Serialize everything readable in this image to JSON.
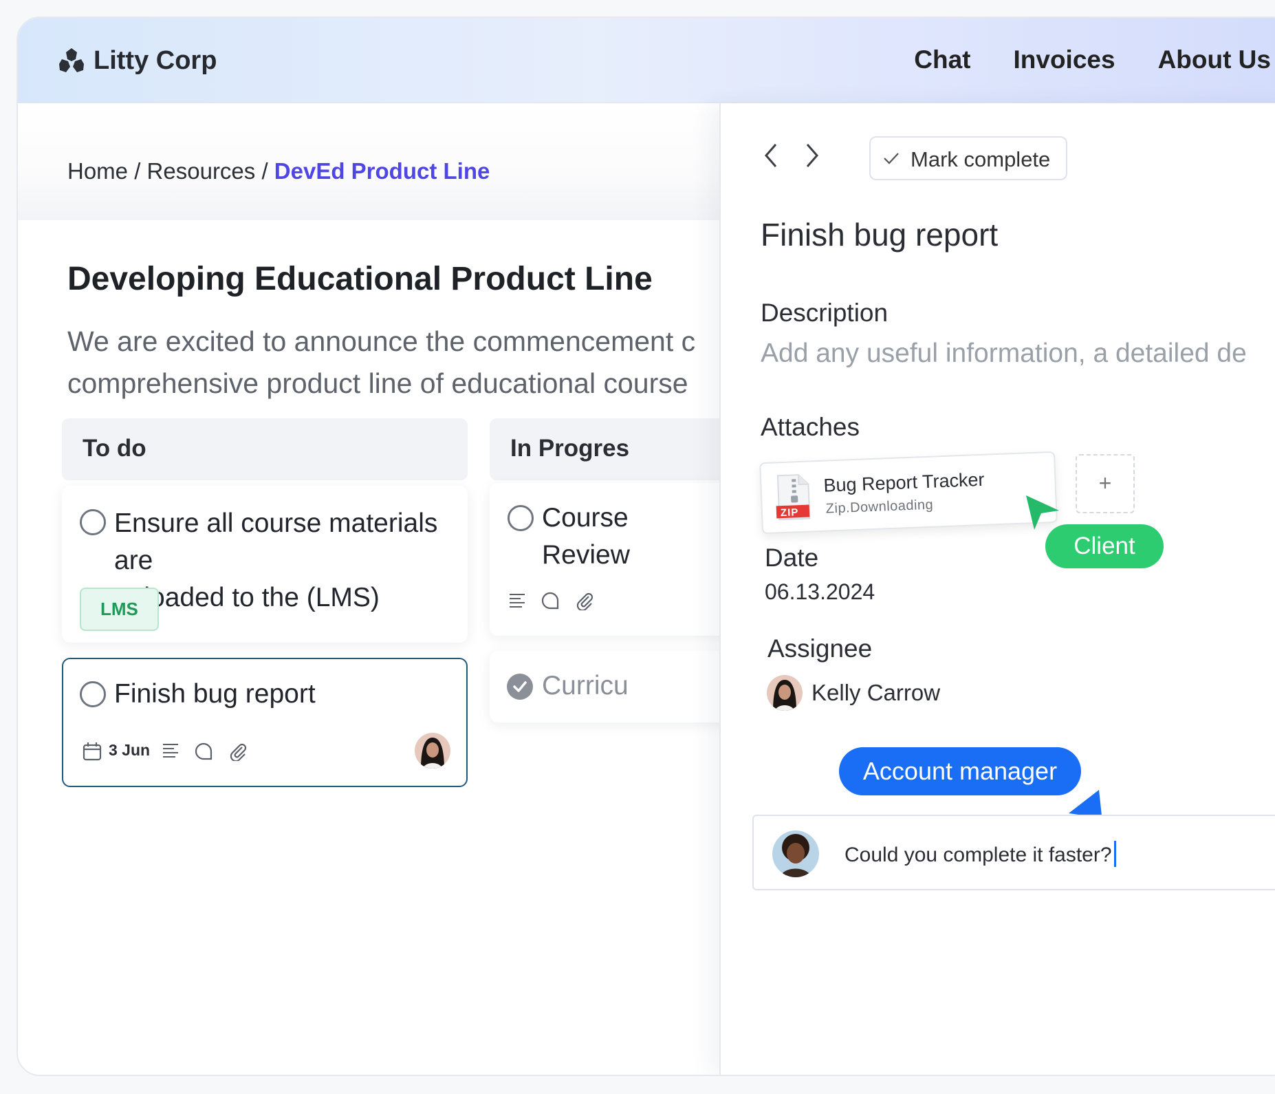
{
  "brand": {
    "name": "Litty Corp"
  },
  "nav": [
    "Chat",
    "Invoices",
    "About Us"
  ],
  "breadcrumb": {
    "home": "Home",
    "sep1": " / ",
    "resources": "Resources",
    "sep2": " / ",
    "current": "DevEd Product Line"
  },
  "page": {
    "title": "Developing Educational Product Line",
    "intro_line1": "We are excited to announce the commencement c",
    "intro_line2": "comprehensive product line of educational course"
  },
  "columns": {
    "todo": {
      "label": "To do",
      "cards": [
        {
          "title_line1": "Ensure all course materials are",
          "title_line2": "uploaded to the (LMS)",
          "tag": "LMS"
        },
        {
          "title": "Finish bug report",
          "date": "3 Jun"
        }
      ]
    },
    "inprogress": {
      "label": "In Progres",
      "cards": [
        {
          "title_line1": "Course",
          "title_line2": "Review"
        },
        {
          "title": "Curricu"
        }
      ]
    }
  },
  "detail": {
    "mark_complete": "Mark complete",
    "title": "Finish bug report",
    "description_label": "Description",
    "description_placeholder": "Add any useful information, a detailed de",
    "attaches_label": "Attaches",
    "attachment": {
      "name": "Bug Report Tracker",
      "status": "Zip.Downloading",
      "badge": "ZIP"
    },
    "add_symbol": "+",
    "date_label": "Date",
    "date_value": "06.13.2024",
    "assignee_label": "Assignee",
    "assignee_name": "Kelly Carrow",
    "comment_text": "Could you complete it faster?"
  },
  "cursors": {
    "client": "Client",
    "account_manager": "Account manager"
  },
  "colors": {
    "accent": "#4f46e5",
    "client": "#2ecc71",
    "account_manager": "#1a6ef5",
    "tag_green": "#1e9a56"
  }
}
